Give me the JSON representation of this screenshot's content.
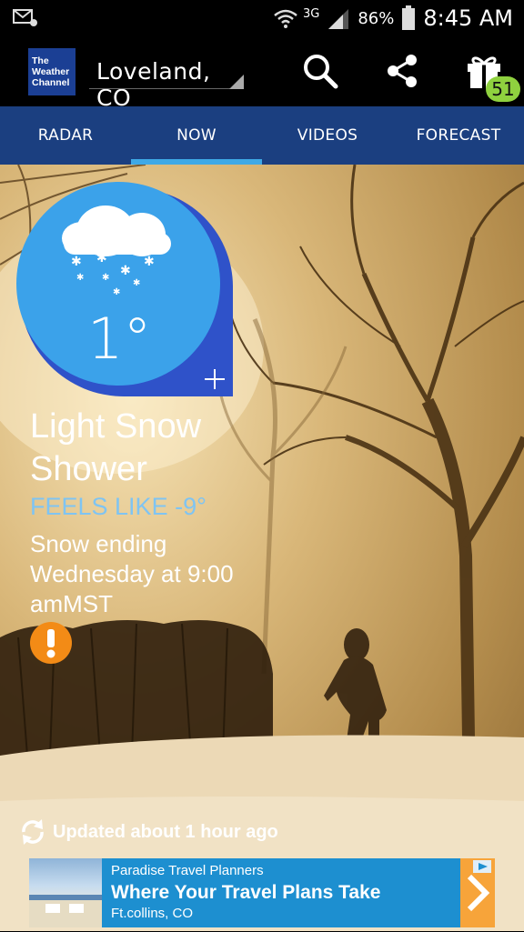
{
  "status_bar": {
    "network": "3G",
    "battery_percent": "86%",
    "time": "8:45 AM"
  },
  "app_bar": {
    "logo_text": "The Weather Channel",
    "location": "Loveland, CO",
    "gift_count": "51"
  },
  "tabs": [
    {
      "label": "RADAR"
    },
    {
      "label": "NOW"
    },
    {
      "label": "VIDEOS"
    },
    {
      "label": "FORECAST"
    }
  ],
  "now": {
    "temperature": "1°",
    "condition": "Light Snow Shower",
    "feels_like": "FEELS LIKE -9°",
    "alert_text": "Snow ending Wednesday at 9:00 amMST",
    "updated": "Updated about 1 hour ago"
  },
  "ad": {
    "line1": "Paradise Travel Planners",
    "line2": "Where Your Travel Plans Take",
    "line3": "Ft.collins, CO"
  },
  "colors": {
    "tab_bar": "#1b3f80",
    "tab_indicator": "#3fa9e6",
    "bubble_light": "#3ba2ea",
    "bubble_dark": "#2f52c9",
    "feels_like": "#7fc4f2",
    "alert_orange": "#f38b16",
    "badge_green": "#8fd13f"
  }
}
